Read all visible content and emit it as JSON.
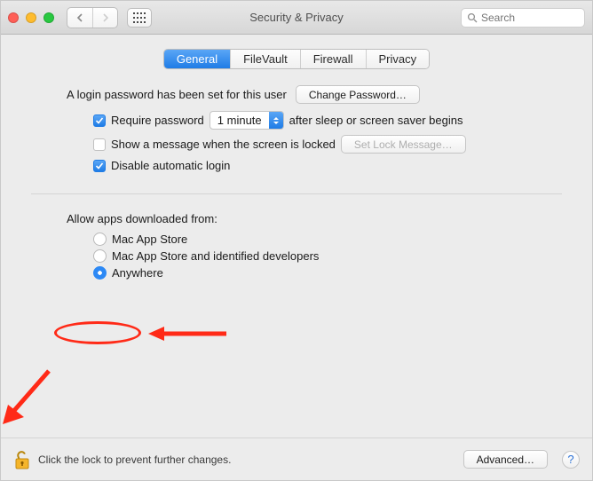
{
  "window_title": "Security & Privacy",
  "search": {
    "placeholder": "Search"
  },
  "tabs": {
    "general": "General",
    "filevault": "FileVault",
    "firewall": "Firewall",
    "privacy": "Privacy"
  },
  "login": {
    "password_set_text": "A login password has been set for this user",
    "change_password_label": "Change Password…",
    "require_password_label": "Require password",
    "require_password_delay": "1 minute",
    "after_sleep_text": "after sleep or screen saver begins",
    "show_message_label": "Show a message when the screen is locked",
    "set_lock_message_label": "Set Lock Message…",
    "disable_auto_login_label": "Disable automatic login"
  },
  "apps": {
    "section_label": "Allow apps downloaded from:",
    "option1": "Mac App Store",
    "option2": "Mac App Store and identified developers",
    "option3": "Anywhere"
  },
  "footer": {
    "lock_text": "Click the lock to prevent further changes.",
    "advanced_label": "Advanced…",
    "help_label": "?"
  },
  "colors": {
    "annotation": "#ff2a17"
  }
}
